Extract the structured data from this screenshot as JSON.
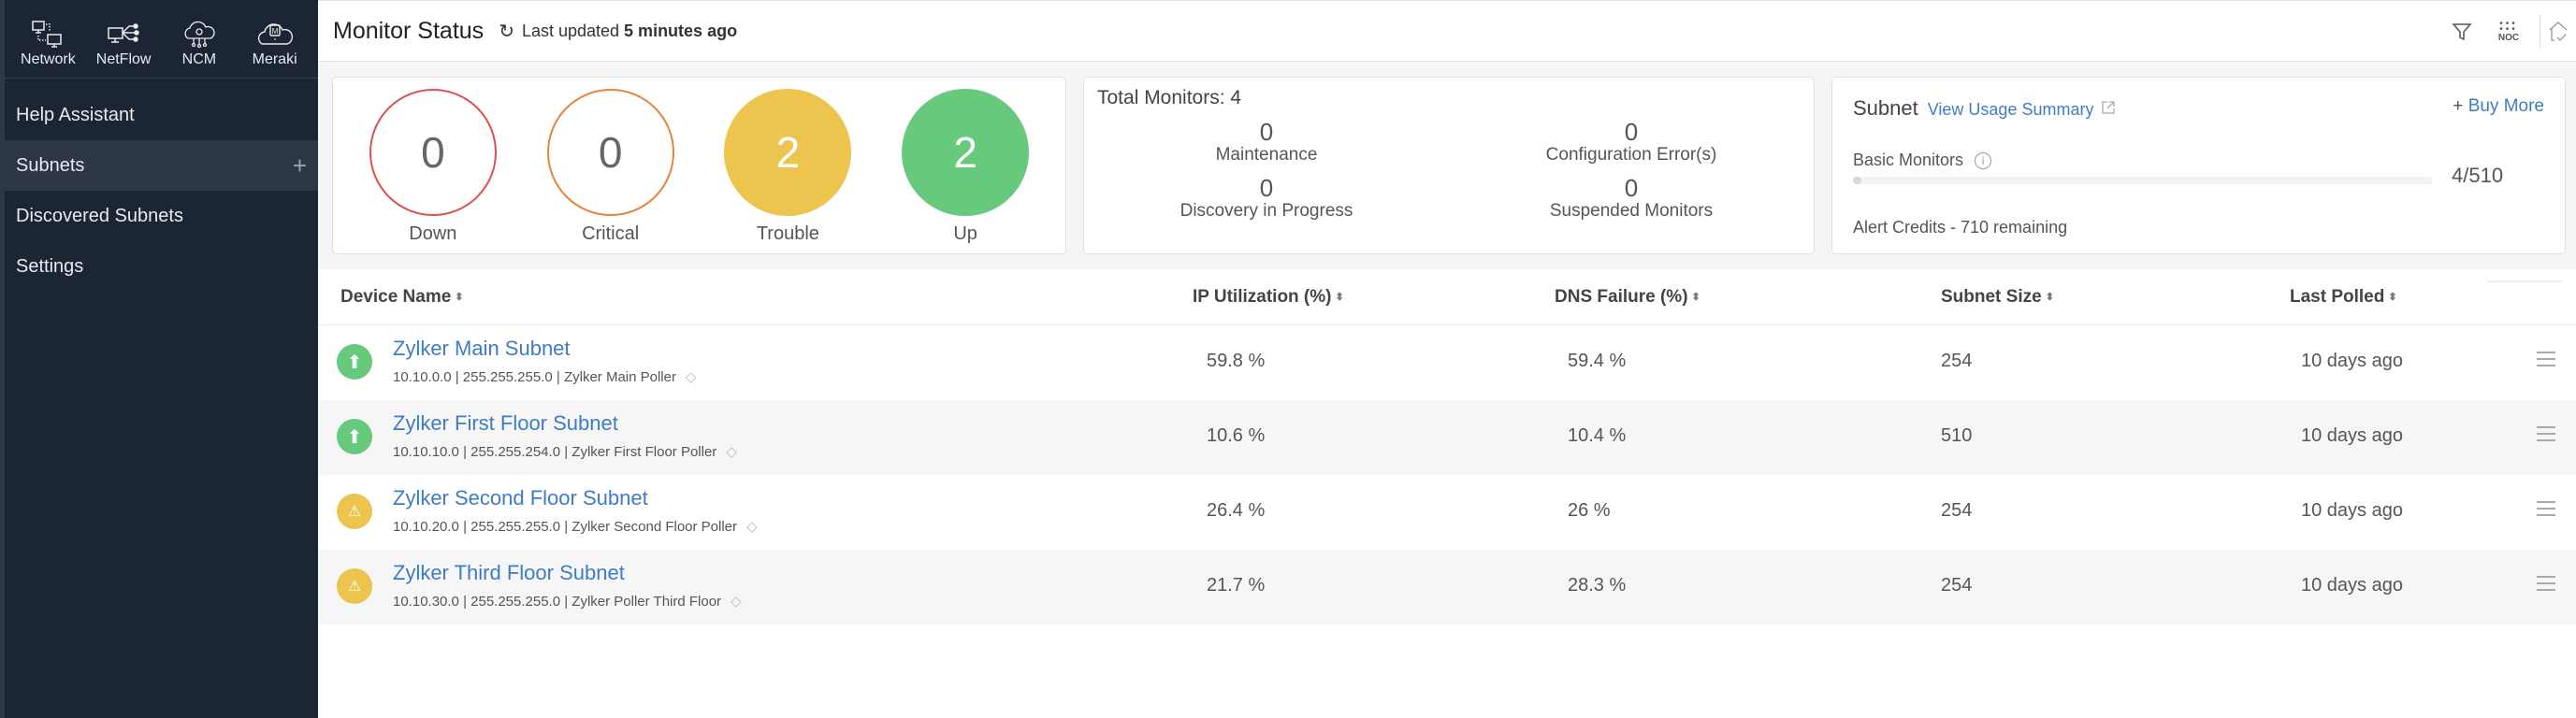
{
  "sidebar": {
    "apps": [
      {
        "label": "Network",
        "icon": "network-icon"
      },
      {
        "label": "NetFlow",
        "icon": "netflow-icon"
      },
      {
        "label": "NCM",
        "icon": "ncm-icon"
      },
      {
        "label": "Meraki",
        "icon": "meraki-icon"
      }
    ],
    "items": [
      {
        "label": "Help Assistant",
        "active": false
      },
      {
        "label": "Subnets",
        "active": true,
        "action": "+"
      },
      {
        "label": "Discovered Subnets",
        "active": false
      },
      {
        "label": "Settings",
        "active": false
      }
    ]
  },
  "header": {
    "title": "Monitor Status",
    "refresh_icon": "↻",
    "updated_prefix": "Last updated ",
    "updated_value": "5 minutes ago",
    "tools": {
      "filter_icon": "filter-icon",
      "noc_label": "NOC",
      "noc_dots": "•••",
      "home_icon": "home-icon"
    }
  },
  "status_summary": [
    {
      "label": "Down",
      "count": "0",
      "color": "#d9534f"
    },
    {
      "label": "Critical",
      "count": "0",
      "color": "#e8833a"
    },
    {
      "label": "Trouble",
      "count": "2",
      "color": "#ecc44e"
    },
    {
      "label": "Up",
      "count": "2",
      "color": "#66c97c"
    }
  ],
  "total_monitors": {
    "title": "Total Monitors: 4",
    "stats": [
      {
        "value": "0",
        "label": "Maintenance"
      },
      {
        "value": "0",
        "label": "Configuration Error(s)"
      },
      {
        "value": "0",
        "label": "Discovery in Progress"
      },
      {
        "value": "0",
        "label": "Suspended Monitors"
      }
    ]
  },
  "subnet_card": {
    "title": "Subnet",
    "usage_link": "View Usage Summary",
    "buy_plus": "+",
    "buy_label": "Buy More",
    "basic_monitors_label": "Basic Monitors",
    "basic_monitors_used": 4,
    "basic_monitors_total": 510,
    "basic_monitors_text": "4/510",
    "alert_credits": "Alert Credits - 710 remaining"
  },
  "table": {
    "columns": [
      "Device Name",
      "IP Utilization (%)",
      "DNS Failure (%)",
      "Subnet Size",
      "Last Polled"
    ],
    "sort_icon": "⬍",
    "rows": [
      {
        "status": "up",
        "name": "Zylker Main Subnet",
        "meta": "10.10.0.0 | 255.255.255.0 | Zylker Main Poller",
        "ip_util": "59.8 %",
        "dns_fail": "59.4 %",
        "size": "254",
        "polled": "10 days ago"
      },
      {
        "status": "up",
        "name": "Zylker First Floor Subnet",
        "meta": "10.10.10.0 | 255.255.254.0 | Zylker First Floor Poller",
        "ip_util": "10.6 %",
        "dns_fail": "10.4 %",
        "size": "510",
        "polled": "10 days ago"
      },
      {
        "status": "trouble",
        "name": "Zylker Second Floor Subnet",
        "meta": "10.10.20.0 | 255.255.255.0 | Zylker Second Floor Poller",
        "ip_util": "26.4 %",
        "dns_fail": "26 %",
        "size": "254",
        "polled": "10 days ago"
      },
      {
        "status": "trouble",
        "name": "Zylker Third Floor Subnet",
        "meta": "10.10.30.0 | 255.255.255.0 | Zylker Poller Third Floor",
        "ip_util": "21.7 %",
        "dns_fail": "28.3 %",
        "size": "254",
        "polled": "10 days ago"
      }
    ]
  },
  "icons": {
    "status_up": "⬆",
    "status_trouble": "⚠",
    "tag": "◇"
  }
}
